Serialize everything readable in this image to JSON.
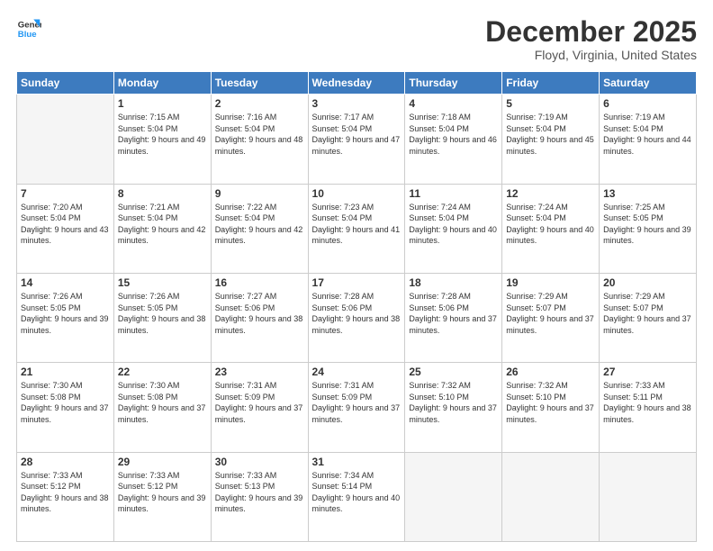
{
  "header": {
    "logo_line1": "General",
    "logo_line2": "Blue",
    "month": "December 2025",
    "location": "Floyd, Virginia, United States"
  },
  "weekdays": [
    "Sunday",
    "Monday",
    "Tuesday",
    "Wednesday",
    "Thursday",
    "Friday",
    "Saturday"
  ],
  "weeks": [
    [
      {
        "day": "",
        "empty": true
      },
      {
        "day": "1",
        "rise": "7:15 AM",
        "set": "5:04 PM",
        "hours": "9 hours and 49 minutes."
      },
      {
        "day": "2",
        "rise": "7:16 AM",
        "set": "5:04 PM",
        "hours": "9 hours and 48 minutes."
      },
      {
        "day": "3",
        "rise": "7:17 AM",
        "set": "5:04 PM",
        "hours": "9 hours and 47 minutes."
      },
      {
        "day": "4",
        "rise": "7:18 AM",
        "set": "5:04 PM",
        "hours": "9 hours and 46 minutes."
      },
      {
        "day": "5",
        "rise": "7:19 AM",
        "set": "5:04 PM",
        "hours": "9 hours and 45 minutes."
      },
      {
        "day": "6",
        "rise": "7:19 AM",
        "set": "5:04 PM",
        "hours": "9 hours and 44 minutes."
      }
    ],
    [
      {
        "day": "7",
        "rise": "7:20 AM",
        "set": "5:04 PM",
        "hours": "9 hours and 43 minutes."
      },
      {
        "day": "8",
        "rise": "7:21 AM",
        "set": "5:04 PM",
        "hours": "9 hours and 42 minutes."
      },
      {
        "day": "9",
        "rise": "7:22 AM",
        "set": "5:04 PM",
        "hours": "9 hours and 42 minutes."
      },
      {
        "day": "10",
        "rise": "7:23 AM",
        "set": "5:04 PM",
        "hours": "9 hours and 41 minutes."
      },
      {
        "day": "11",
        "rise": "7:24 AM",
        "set": "5:04 PM",
        "hours": "9 hours and 40 minutes."
      },
      {
        "day": "12",
        "rise": "7:24 AM",
        "set": "5:04 PM",
        "hours": "9 hours and 40 minutes."
      },
      {
        "day": "13",
        "rise": "7:25 AM",
        "set": "5:05 PM",
        "hours": "9 hours and 39 minutes."
      }
    ],
    [
      {
        "day": "14",
        "rise": "7:26 AM",
        "set": "5:05 PM",
        "hours": "9 hours and 39 minutes."
      },
      {
        "day": "15",
        "rise": "7:26 AM",
        "set": "5:05 PM",
        "hours": "9 hours and 38 minutes."
      },
      {
        "day": "16",
        "rise": "7:27 AM",
        "set": "5:06 PM",
        "hours": "9 hours and 38 minutes."
      },
      {
        "day": "17",
        "rise": "7:28 AM",
        "set": "5:06 PM",
        "hours": "9 hours and 38 minutes."
      },
      {
        "day": "18",
        "rise": "7:28 AM",
        "set": "5:06 PM",
        "hours": "9 hours and 37 minutes."
      },
      {
        "day": "19",
        "rise": "7:29 AM",
        "set": "5:07 PM",
        "hours": "9 hours and 37 minutes."
      },
      {
        "day": "20",
        "rise": "7:29 AM",
        "set": "5:07 PM",
        "hours": "9 hours and 37 minutes."
      }
    ],
    [
      {
        "day": "21",
        "rise": "7:30 AM",
        "set": "5:08 PM",
        "hours": "9 hours and 37 minutes."
      },
      {
        "day": "22",
        "rise": "7:30 AM",
        "set": "5:08 PM",
        "hours": "9 hours and 37 minutes."
      },
      {
        "day": "23",
        "rise": "7:31 AM",
        "set": "5:09 PM",
        "hours": "9 hours and 37 minutes."
      },
      {
        "day": "24",
        "rise": "7:31 AM",
        "set": "5:09 PM",
        "hours": "9 hours and 37 minutes."
      },
      {
        "day": "25",
        "rise": "7:32 AM",
        "set": "5:10 PM",
        "hours": "9 hours and 37 minutes."
      },
      {
        "day": "26",
        "rise": "7:32 AM",
        "set": "5:10 PM",
        "hours": "9 hours and 37 minutes."
      },
      {
        "day": "27",
        "rise": "7:33 AM",
        "set": "5:11 PM",
        "hours": "9 hours and 38 minutes."
      }
    ],
    [
      {
        "day": "28",
        "rise": "7:33 AM",
        "set": "5:12 PM",
        "hours": "9 hours and 38 minutes."
      },
      {
        "day": "29",
        "rise": "7:33 AM",
        "set": "5:12 PM",
        "hours": "9 hours and 39 minutes."
      },
      {
        "day": "30",
        "rise": "7:33 AM",
        "set": "5:13 PM",
        "hours": "9 hours and 39 minutes."
      },
      {
        "day": "31",
        "rise": "7:34 AM",
        "set": "5:14 PM",
        "hours": "9 hours and 40 minutes."
      },
      {
        "day": "",
        "empty": true
      },
      {
        "day": "",
        "empty": true
      },
      {
        "day": "",
        "empty": true
      }
    ]
  ]
}
